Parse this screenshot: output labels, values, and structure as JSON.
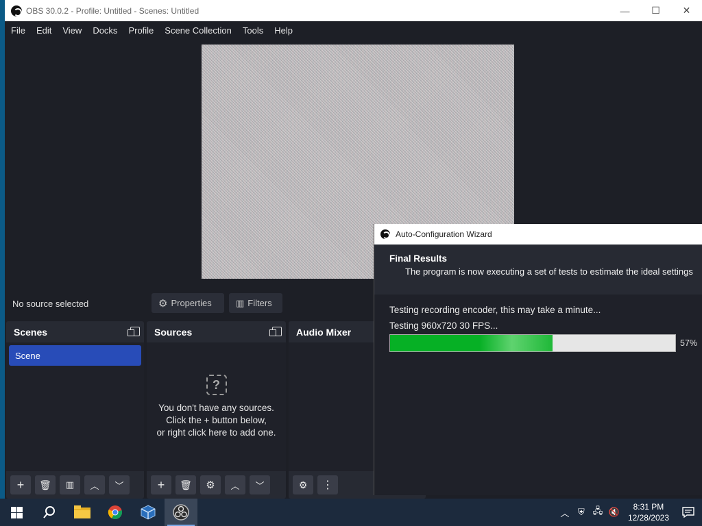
{
  "window": {
    "title": "OBS 30.0.2 - Profile: Untitled - Scenes: Untitled",
    "controls": {
      "minimize": "—",
      "maximize": "☐",
      "close": "✕"
    }
  },
  "menu": [
    "File",
    "Edit",
    "View",
    "Docks",
    "Profile",
    "Scene Collection",
    "Tools",
    "Help"
  ],
  "context_bar": {
    "status": "No source selected",
    "properties_label": "Properties",
    "filters_label": "Filters"
  },
  "docks": {
    "scenes": {
      "title": "Scenes",
      "items": [
        "Scene"
      ]
    },
    "sources": {
      "title": "Sources",
      "empty_line1": "You don't have any sources.",
      "empty_line2": "Click the + button below,",
      "empty_line3": "or right click here to add one."
    },
    "audio_mixer": {
      "title": "Audio Mixer"
    }
  },
  "wizard": {
    "title": "Auto-Configuration Wizard",
    "header": "Final Results",
    "subheader": "The program is now executing a set of tests to estimate the ideal settings",
    "status_line1": "Testing recording encoder, this may take a minute...",
    "status_line2": "Testing 960x720 30 FPS...",
    "progress_value": 57,
    "progress_text": "57%"
  },
  "taskbar": {
    "apps": [
      "start",
      "search",
      "file-explorer",
      "chrome",
      "virtualbox",
      "obs"
    ],
    "clock_time": "8:31 PM",
    "clock_date": "12/28/2023"
  },
  "colors": {
    "accent": "#284cb8",
    "progress": "#06b025",
    "obs_bg": "#1d1f26"
  }
}
